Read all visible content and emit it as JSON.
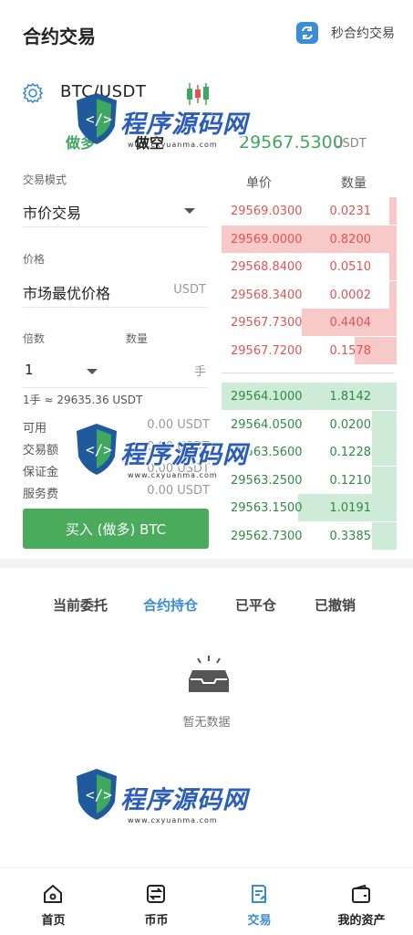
{
  "header": {
    "title": "合约交易",
    "switch_label": "秒合约交易",
    "switch_icon": "swap-icon"
  },
  "pair": {
    "settings_icon": "gear-icon",
    "name": "BTC/USDT",
    "chart_icon": "kline-icon"
  },
  "tabs": {
    "long": "做多",
    "short": "做空"
  },
  "ticker": {
    "price": "29567.5300",
    "unit": "USDT"
  },
  "form": {
    "mode_label": "交易模式",
    "mode_value": "市价交易",
    "price_label": "价格",
    "price_value": "市场最优价格",
    "price_unit": "USDT",
    "leverage_label": "倍数",
    "leverage_value": "1",
    "quantity_label": "数量",
    "quantity_unit": "手",
    "conversion": "1手 ≈ 29635.36 USDT",
    "available_label": "可用",
    "available_value": "0.00 USDT",
    "amount_label": "交易额",
    "amount_value": "0.00 USDT",
    "margin_label": "保证金",
    "margin_value": "0.00 USDT",
    "fee_label": "服务费",
    "fee_value": "0.00 USDT",
    "buy_button": "买入 (做多) BTC"
  },
  "order_book": {
    "price_header": "单价",
    "qty_header": "数量",
    "asks": [
      {
        "price": "29569.0300",
        "qty": "0.0231",
        "depth": 0.04
      },
      {
        "price": "29569.0000",
        "qty": "0.8200",
        "depth": 1.0
      },
      {
        "price": "29568.8400",
        "qty": "0.0510",
        "depth": 0.04
      },
      {
        "price": "29568.3400",
        "qty": "0.0002",
        "depth": 0.04
      },
      {
        "price": "29567.7300",
        "qty": "0.4404",
        "depth": 0.54
      },
      {
        "price": "29567.7200",
        "qty": "0.1578",
        "depth": 0.24
      }
    ],
    "bids": [
      {
        "price": "29564.1000",
        "qty": "1.8142",
        "depth": 1.0
      },
      {
        "price": "29564.0500",
        "qty": "0.0200",
        "depth": 0.14
      },
      {
        "price": "29563.5600",
        "qty": "0.1228",
        "depth": 0.14
      },
      {
        "price": "29563.2500",
        "qty": "0.1210",
        "depth": 0.14
      },
      {
        "price": "29563.1500",
        "qty": "1.0191",
        "depth": 0.56
      },
      {
        "price": "29562.7300",
        "qty": "0.3385",
        "depth": 0.14
      }
    ]
  },
  "orders": {
    "tabs": [
      "当前委托",
      "合约持仓",
      "已平仓",
      "已撤销"
    ],
    "active_tab": 1,
    "empty_text": "暂无数据",
    "empty_icon": "inbox-icon"
  },
  "nav": [
    {
      "label": "首页",
      "icon": "home-icon"
    },
    {
      "label": "币币",
      "icon": "exchange-icon"
    },
    {
      "label": "交易",
      "icon": "trade-icon",
      "active": true
    },
    {
      "label": "我的资产",
      "icon": "wallet-icon"
    }
  ],
  "watermark": {
    "text": "程序源码网",
    "url": "www.cxyuanma.com"
  },
  "colors": {
    "up": "#3fa75f",
    "down": "#e15454",
    "accent": "#3a8bd1",
    "buy_button": "#4aab5c"
  }
}
